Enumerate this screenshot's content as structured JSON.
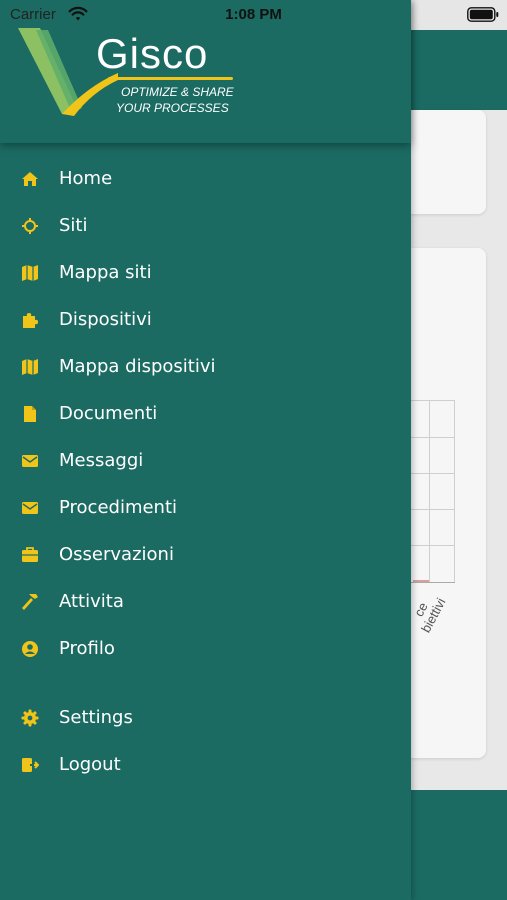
{
  "status_bar": {
    "carrier": "Carrier",
    "time": "1:08 PM"
  },
  "logo": {
    "name": "Gisco",
    "tagline_line1": "OPTIMIZE & SHARE",
    "tagline_line2": "YOUR PROCESSES"
  },
  "menu": {
    "items": [
      {
        "label": "Home",
        "icon": "home-icon"
      },
      {
        "label": "Siti",
        "icon": "crosshair-icon"
      },
      {
        "label": "Mappa siti",
        "icon": "map-icon"
      },
      {
        "label": "Dispositivi",
        "icon": "puzzle-icon"
      },
      {
        "label": "Mappa dispositivi",
        "icon": "map-icon"
      },
      {
        "label": "Documenti",
        "icon": "file-icon"
      },
      {
        "label": "Messaggi",
        "icon": "envelope-icon"
      },
      {
        "label": "Procedimenti",
        "icon": "envelope-icon"
      },
      {
        "label": "Osservazioni",
        "icon": "briefcase-icon"
      },
      {
        "label": "Attivita",
        "icon": "hammer-icon"
      },
      {
        "label": "Profilo",
        "icon": "user-circle-icon"
      },
      {
        "label": "Settings",
        "icon": "gear-icon"
      },
      {
        "label": "Logout",
        "icon": "logout-icon"
      }
    ]
  },
  "background": {
    "tick_label_1": "ce",
    "tick_label_2": "biettivi"
  },
  "colors": {
    "drawer": "#1b6b63",
    "icon": "#f0c419",
    "text": "#ffffff"
  }
}
